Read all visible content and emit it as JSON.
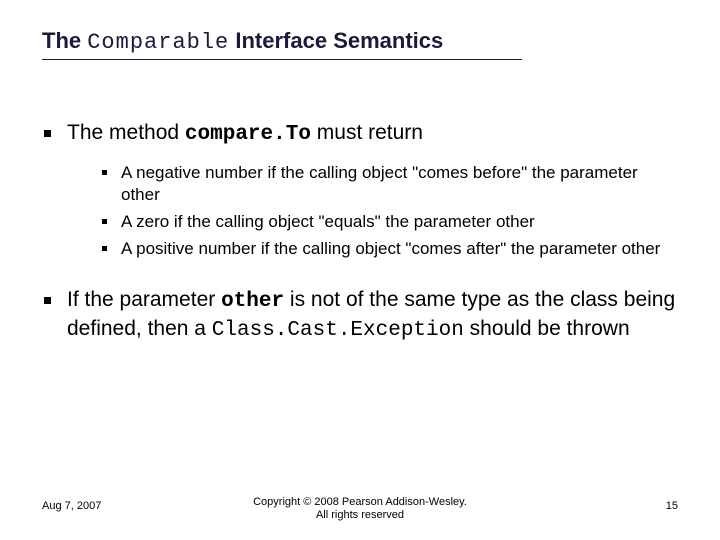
{
  "title": {
    "pre": "The ",
    "mono": "Comparable",
    "post": " Interface Semantics"
  },
  "bullets": [
    {
      "text_pre": "The method ",
      "text_mono": "compare.To",
      "text_post": " must return",
      "sub": [
        "A negative number if the calling object \"comes before\" the parameter other",
        "A zero if the calling object \"equals\" the parameter other",
        "A positive number if the calling object \"comes after\" the parameter other"
      ]
    },
    {
      "text_pre": "If the parameter ",
      "text_mono": "other",
      "text_post": " is not of the same type as the class being defined, then a ",
      "text_mono2": "Class.Cast.Exception",
      "text_post2": " should be thrown",
      "sub": []
    }
  ],
  "footer": {
    "date": "Aug 7, 2007",
    "copyright_line1": "Copyright © 2008 Pearson Addison-Wesley.",
    "copyright_line2": "All rights reserved",
    "page": "15"
  }
}
